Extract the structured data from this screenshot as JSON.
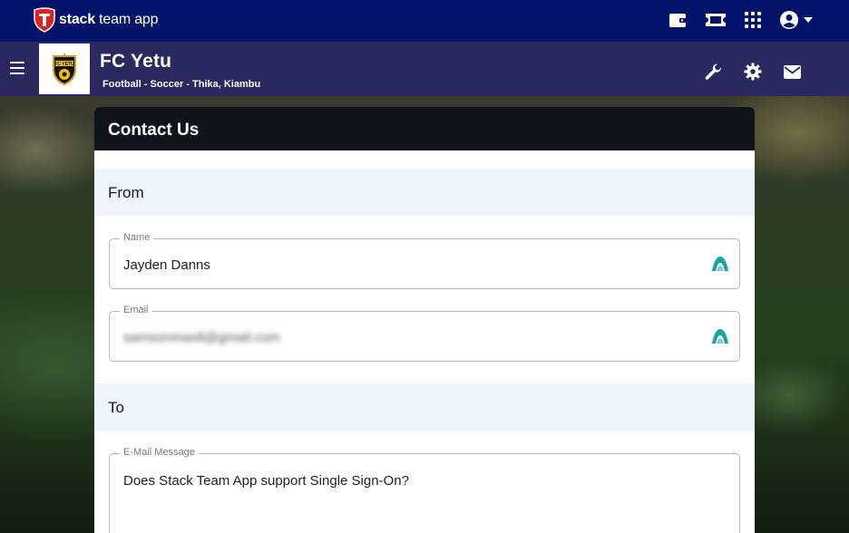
{
  "app": {
    "brand_bold": "stack",
    "brand_rest": " team app"
  },
  "topbar": {
    "icons": [
      "wallet-icon",
      "ticket-icon",
      "apps-grid-icon",
      "account-icon"
    ]
  },
  "team": {
    "name": "FC Yetu",
    "subtitle": "Football - Soccer - Thika, Kiambu",
    "logo_text": "FC YETU"
  },
  "teambar": {
    "icons": [
      "wrench-icon",
      "gear-icon",
      "mail-icon"
    ]
  },
  "card": {
    "title": "Contact Us",
    "from_label": "From",
    "to_label": "To",
    "name_field": {
      "label": "Name",
      "value": "Jayden Danns"
    },
    "email_field": {
      "label": "Email",
      "value": "samsonmax8@gmail.com"
    },
    "message_field": {
      "label": "E-Mail Message",
      "value": "Does Stack Team App support Single Sign-On?"
    }
  },
  "colors": {
    "topbar": "#03136a",
    "teambar": "#2a2a60",
    "card_header": "#0e1419",
    "section_bg": "#eef4fc",
    "accent_icon": "#1aa3a3"
  }
}
